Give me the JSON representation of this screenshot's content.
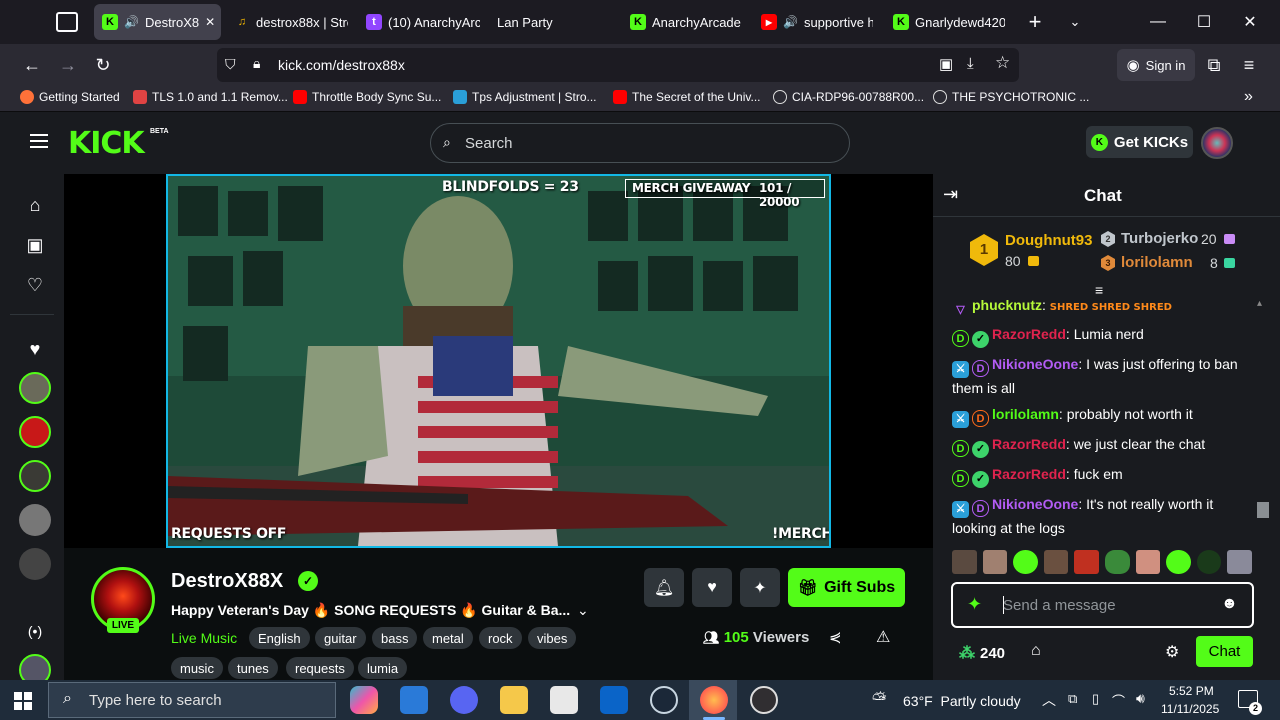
{
  "browser": {
    "tabs": [
      {
        "label": "DestroX8",
        "icon": "kick-icon",
        "audio": true,
        "active": true,
        "close": "✕"
      },
      {
        "label": "destrox88x | Stre",
        "icon": "music-note-icon"
      },
      {
        "label": "(10) AnarchyArca",
        "icon": "twitch-icon"
      },
      {
        "label": "Lan Party",
        "icon": ""
      },
      {
        "label": "AnarchyArcade S",
        "icon": "kick-icon"
      },
      {
        "label": "supportive h",
        "icon": "youtube-icon",
        "audio": true
      },
      {
        "label": "Gnarlydewd420 S",
        "icon": "kick-icon"
      }
    ],
    "url": "kick.com/destrox88x",
    "sign_in": "Sign in",
    "bookmarks": [
      {
        "label": "Getting Started",
        "color": "#ff7139"
      },
      {
        "label": "TLS 1.0 and 1.1 Remov...",
        "color": "#e04343"
      },
      {
        "label": "Throttle Body Sync Su...",
        "color": "#ff0000"
      },
      {
        "label": "Tps Adjustment | Stro...",
        "color": "#2a9fd8"
      },
      {
        "label": "The Secret of the Univ...",
        "color": "#ff0000"
      },
      {
        "label": "CIA-RDP96-00788R00...",
        "color": "#dddddd"
      },
      {
        "label": "THE PSYCHOTRONIC ...",
        "color": "#dddddd"
      }
    ]
  },
  "kick": {
    "logo": "KICK",
    "beta": "BETA",
    "search_placeholder": "Search",
    "get_kicks": "Get KICKs",
    "accent": "#53fc18"
  },
  "video": {
    "overlay_top": "BLINDFOLDS = 23",
    "merch_giveaway": "MERCH GIVEAWAY",
    "merch_count": "101 / 20000",
    "requests": "REQUESTS OFF",
    "merch": "!MERCH"
  },
  "stream": {
    "channel": "DestroX88X",
    "live_badge": "LIVE",
    "title": "Happy Veteran's Day 🔥 SONG REQUESTS 🔥 Guitar & Ba...",
    "category": "Live Music",
    "tags": [
      "English",
      "guitar",
      "bass",
      "metal",
      "rock",
      "vibes",
      "music",
      "tunes",
      "requests",
      "lumia"
    ],
    "gift_subs": "Gift Subs",
    "viewers_count": "105",
    "viewers_label": "Viewers"
  },
  "chat": {
    "title": "Chat",
    "leaders": [
      {
        "rank": "1",
        "name": "Doughnut93",
        "points": "80"
      },
      {
        "rank": "2",
        "name": "Turbojerko",
        "points": "20"
      },
      {
        "rank": "3",
        "name": "lorilolamn",
        "points": "8"
      }
    ],
    "messages": [
      {
        "user": "phucknutz",
        "text": "SHRED  SHRED  SHRED",
        "color": "#b6f93a"
      },
      {
        "user": "RazorRedd",
        "text": "Lumia nerd",
        "color": "#e0234e"
      },
      {
        "user": "NikioneOone",
        "text": "I was just offering to ban them is all",
        "color": "#b35cf5"
      },
      {
        "user": "lorilolamn",
        "text": "probably not worth it",
        "color": "#53fc18"
      },
      {
        "user": "RazorRedd",
        "text": "we just clear the chat",
        "color": "#e0234e"
      },
      {
        "user": "RazorRedd",
        "text": "fuck em",
        "color": "#e0234e"
      },
      {
        "user": "NikioneOone",
        "text": "It's not really worth it looking at the logs",
        "color": "#b35cf5"
      }
    ],
    "input_placeholder": "Send a message",
    "points": "240",
    "send": "Chat"
  },
  "taskbar": {
    "search_placeholder": "Type here to search",
    "weather": "63°F  Partly cloudy",
    "time": "5:52 PM",
    "date": "11/11/2025",
    "notifications": "2"
  }
}
